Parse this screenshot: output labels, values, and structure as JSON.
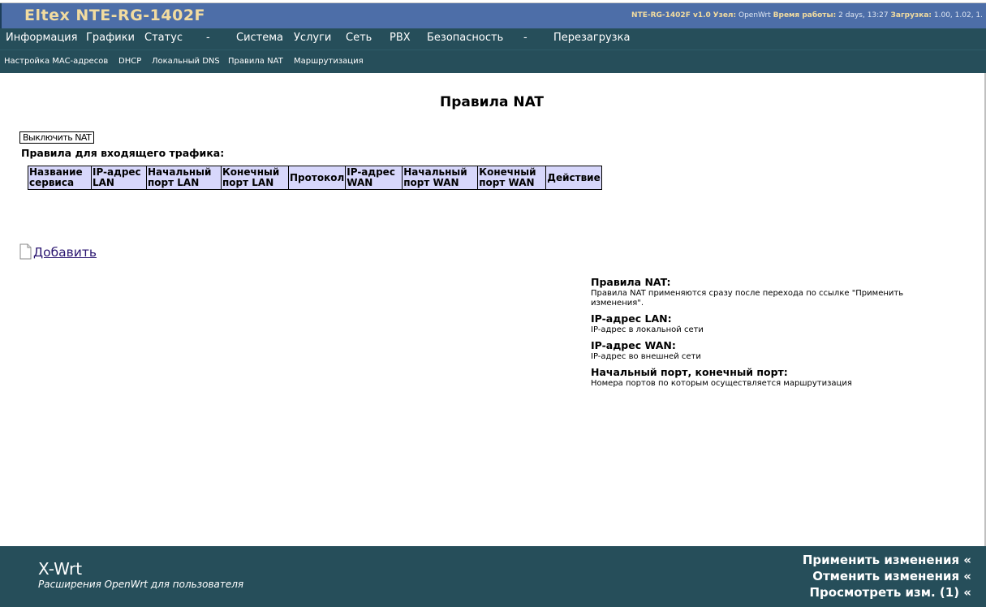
{
  "header": {
    "title": "Eltex NTE-RG-1402F",
    "status": {
      "device": "NTE-RG-1402F v1.0",
      "host_label": "Узел:",
      "host_value": "OpenWrt",
      "uptime_label": "Время работы:",
      "uptime_value": "2 days, 13:27",
      "load_label": "Загрузка:",
      "load_value": "1.00, 1.02, 1."
    }
  },
  "nav": {
    "items": [
      "Информация",
      "Графики",
      "Статус",
      "-",
      "Система",
      "Услуги",
      "Сеть",
      "PBX",
      "Безопасность",
      "-",
      "Перезагрузка"
    ]
  },
  "subnav": {
    "items": [
      "Настройка MAC-адресов",
      "DHCP",
      "Локальный DNS",
      "Правила NAT",
      "Маршрутизация"
    ]
  },
  "main": {
    "title": "Правила NAT",
    "toggle_button": "Выключить NAT",
    "rules_heading": "Правила для входящего трафика:",
    "table_headers": [
      [
        "Название",
        "сервиса"
      ],
      [
        "IP-адрес",
        "LAN"
      ],
      [
        "Начальный",
        "порт LAN"
      ],
      [
        "Конечный",
        "порт LAN"
      ],
      [
        "Протокол"
      ],
      [
        "IP-адрес",
        "WAN"
      ],
      [
        "Начальный",
        "порт WAN"
      ],
      [
        "Конечный",
        "порт WAN"
      ],
      [
        "Действие"
      ]
    ],
    "add_link": "Добавить",
    "add_icon": "document-icon"
  },
  "help": [
    {
      "title": "Правила NAT:",
      "text": "Правила NAT применяются сразу после перехода по ссылке \"Применить изменения\"."
    },
    {
      "title": "IP-адрес LAN:",
      "text": "IP-адрес в локальной сети"
    },
    {
      "title": "IP-адрес WAN:",
      "text": "IP-адрес во внешней сети"
    },
    {
      "title": "Начальный порт, конечный порт:",
      "text": "Номера портов по которым осуществляется маршрутизация"
    }
  ],
  "footer": {
    "brand": "X-Wrt",
    "tagline": "Расширения OpenWrt для пользователя",
    "apply": "Применить изменения «",
    "cancel": "Отменить изменения «",
    "review": "Просмотреть изм. (1) «"
  },
  "colors": {
    "header_bg": "#4d6ea8",
    "nav_bg": "#264e5a",
    "title_color": "#f2dca0",
    "table_header_bg": "#d7d7fb"
  }
}
